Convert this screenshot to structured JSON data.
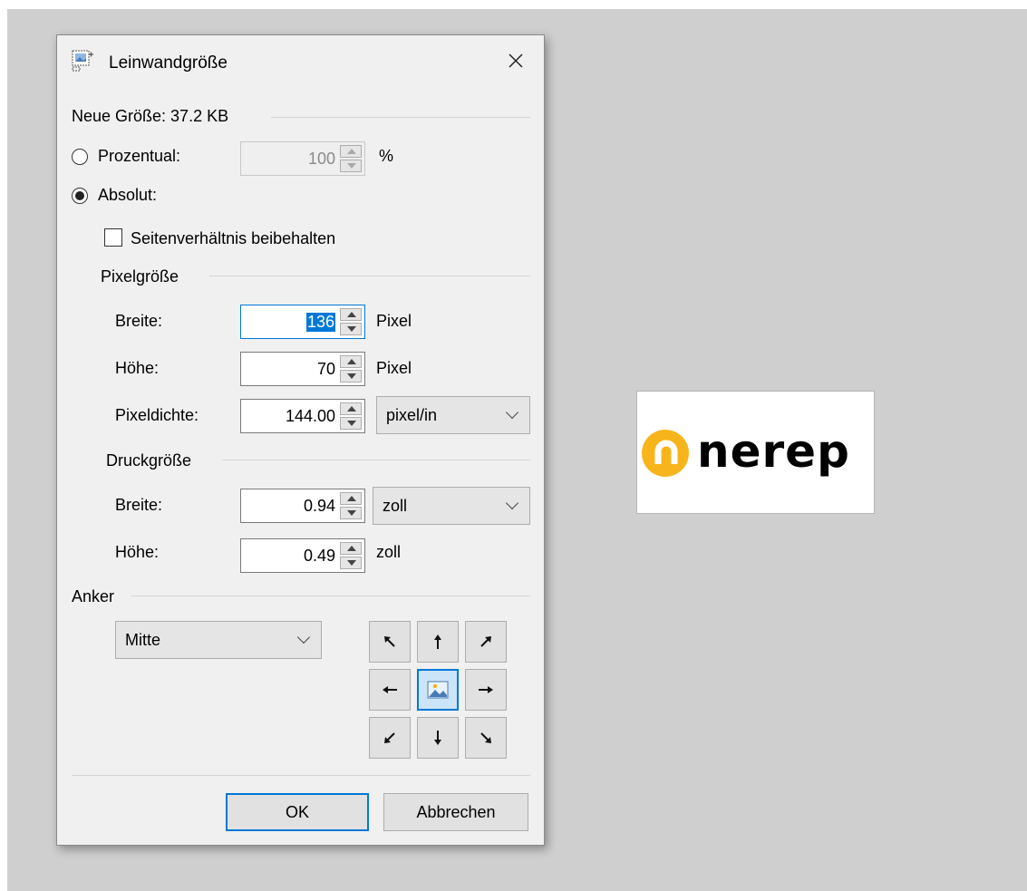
{
  "dialog": {
    "title": "Leinwandgröße",
    "new_size_label": "Neue Größe: 37.2 KB",
    "percent_option": {
      "label": "Prozentual:",
      "checked": false,
      "value": "100",
      "unit": "%"
    },
    "absolute_option": {
      "label": "Absolut:",
      "checked": true
    },
    "keep_aspect": {
      "label": "Seitenverhältnis beibehalten",
      "checked": false
    },
    "pixel_size": {
      "group_label": "Pixelgröße",
      "width": {
        "label": "Breite:",
        "value": "136",
        "unit": "Pixel"
      },
      "height": {
        "label": "Höhe:",
        "value": "70",
        "unit": "Pixel"
      },
      "density": {
        "label": "Pixeldichte:",
        "value": "144.00",
        "unit": "pixel/in"
      }
    },
    "print_size": {
      "group_label": "Druckgröße",
      "width": {
        "label": "Breite:",
        "value": "0.94",
        "unit": "zoll"
      },
      "height": {
        "label": "Höhe:",
        "value": "0.49",
        "unit": "zoll"
      }
    },
    "anchor": {
      "group_label": "Anker",
      "selected": "Mitte"
    },
    "buttons": {
      "ok": "OK",
      "cancel": "Abbrechen"
    }
  },
  "preview": {
    "logo_text": "nerep",
    "logo_color": "#f7b51b"
  },
  "colors": {
    "accent": "#0078d7",
    "workspace": "#cfcfcf",
    "dialog_bg": "#f0f0f0"
  }
}
